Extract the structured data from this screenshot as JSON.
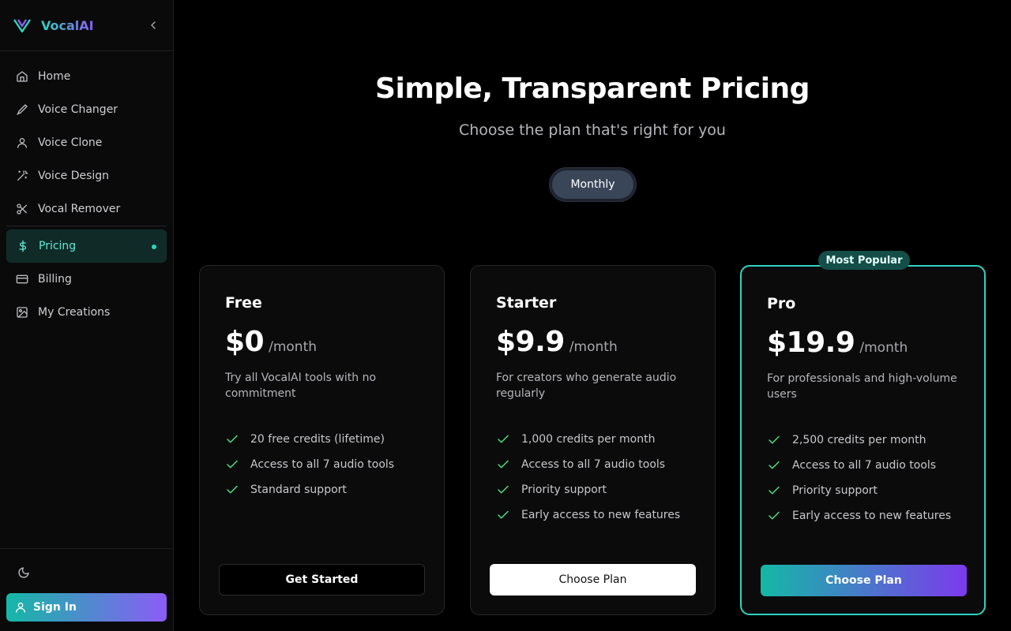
{
  "brand": {
    "name": "VocalAI"
  },
  "sidebar": {
    "items": [
      {
        "label": "Home",
        "icon": "home-icon"
      },
      {
        "label": "Voice Changer",
        "icon": "pen-icon"
      },
      {
        "label": "Voice Clone",
        "icon": "user-icon"
      },
      {
        "label": "Voice Design",
        "icon": "wand-icon"
      },
      {
        "label": "Vocal Remover",
        "icon": "scissors-icon"
      },
      {
        "label": "Pricing",
        "icon": "dollar-icon",
        "active": true
      },
      {
        "label": "Billing",
        "icon": "card-icon"
      },
      {
        "label": "My Creations",
        "icon": "image-icon"
      }
    ],
    "sign_in_label": "Sign In"
  },
  "header": {
    "title": "Simple, Transparent Pricing",
    "subtitle": "Choose the plan that's right for you",
    "billing_toggle": "Monthly"
  },
  "plans": [
    {
      "name": "Free",
      "price": "$0",
      "period": "/month",
      "description": "Try all VocalAI tools with no commitment",
      "features": [
        "20 free credits (lifetime)",
        "Access to all 7 audio tools",
        "Standard support"
      ],
      "button": "Get Started"
    },
    {
      "name": "Starter",
      "price": "$9.9",
      "period": "/month",
      "description": "For creators who generate audio regularly",
      "features": [
        "1,000 credits per month",
        "Access to all 7 audio tools",
        "Priority support",
        "Early access to new features"
      ],
      "button": "Choose Plan"
    },
    {
      "name": "Pro",
      "badge": "Most Popular",
      "price": "$19.9",
      "period": "/month",
      "description": "For professionals and high-volume users",
      "features": [
        "2,500 credits per month",
        "Access to all 7 audio tools",
        "Priority support",
        "Early access to new features"
      ],
      "button": "Choose Plan"
    }
  ],
  "colors": {
    "accent": "#2dd4bf",
    "brand_gradient_end": "#8b5cf6",
    "check": "#4ade80"
  }
}
